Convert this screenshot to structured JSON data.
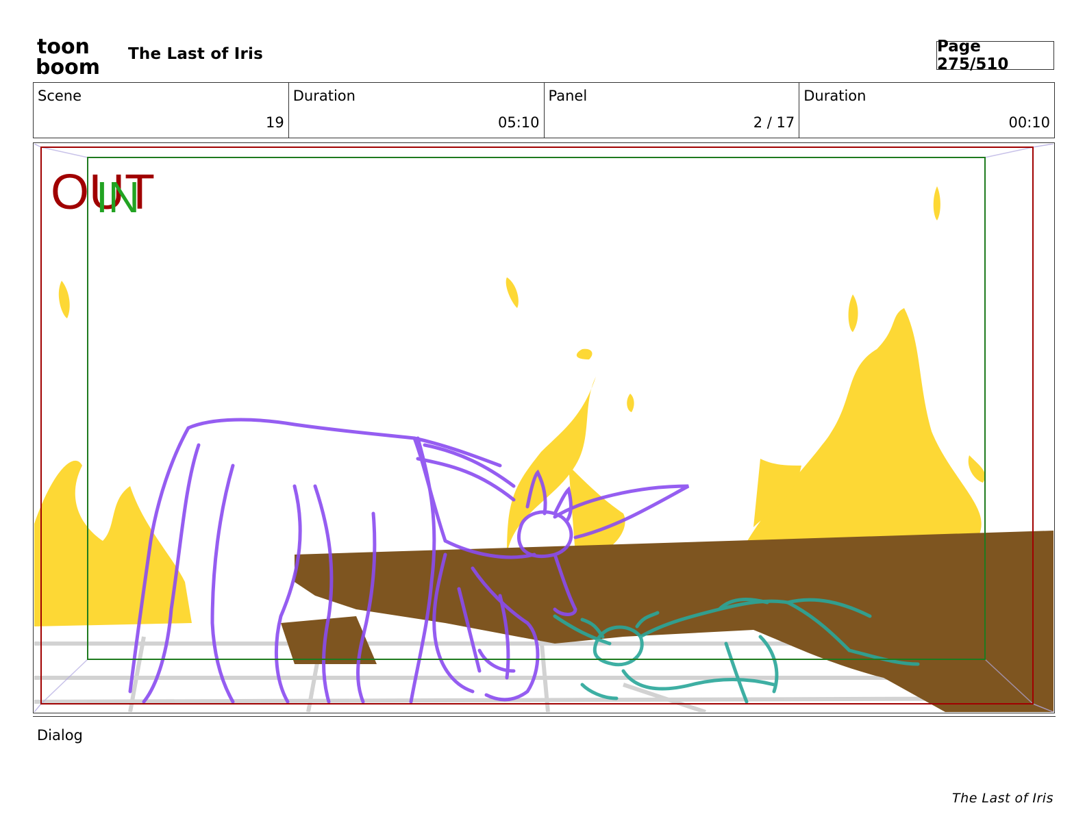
{
  "logo": {
    "line1": "toon",
    "line2": "boom"
  },
  "header": {
    "title": "The Last of Iris",
    "page": "Page 275/510"
  },
  "info": {
    "scene_label": "Scene",
    "scene_value": "19",
    "scene_duration_label": "Duration",
    "scene_duration_value": "05:10",
    "panel_label": "Panel",
    "panel_value": "2 / 17",
    "panel_duration_label": "Duration",
    "panel_duration_value": "00:10"
  },
  "panel": {
    "out_label": "OUT",
    "in_label": "IN",
    "colors": {
      "out_frame": "#a00000",
      "in_frame": "#1e7a1e",
      "fire": "#fdd835",
      "log": "#7e5520",
      "unicorn_line": "#8a4cf0",
      "fawn_line": "#2aa79a",
      "ground_line": "#bdbdbd"
    }
  },
  "dialog_label": "Dialog",
  "footer": {
    "project": "The Last of Iris"
  }
}
